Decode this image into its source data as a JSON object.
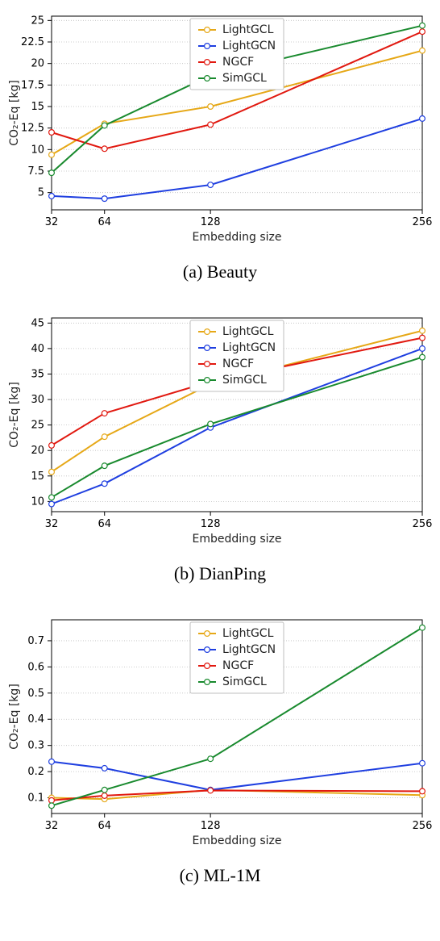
{
  "chart_data": [
    {
      "id": "beauty",
      "type": "line",
      "caption": "(a) Beauty",
      "xlabel": "Embedding size",
      "ylabel": "CO₂-Eq [kg]",
      "x_categories": [
        32,
        64,
        128,
        256
      ],
      "ylim": [
        3.0,
        25.5
      ],
      "yticks": [
        5.0,
        7.5,
        10.0,
        12.5,
        15.0,
        17.5,
        20.0,
        22.5,
        25.0
      ],
      "legend_pos": "top-center",
      "series": [
        {
          "name": "LightGCL",
          "color": "#e6a817",
          "values": [
            9.4,
            13.0,
            15.0,
            21.5
          ]
        },
        {
          "name": "LightGCN",
          "color": "#1f3fe0",
          "values": [
            4.6,
            4.3,
            5.9,
            13.6
          ]
        },
        {
          "name": "NGCF",
          "color": "#e11910",
          "values": [
            12.0,
            10.1,
            12.9,
            23.7
          ]
        },
        {
          "name": "SimGCL",
          "color": "#198a2e",
          "values": [
            7.3,
            12.8,
            18.6,
            24.4
          ]
        }
      ]
    },
    {
      "id": "dianping",
      "type": "line",
      "caption": "(b) DianPing",
      "xlabel": "Embedding size",
      "ylabel": "CO₂-Eq [kg]",
      "x_categories": [
        32,
        64,
        128,
        256
      ],
      "ylim": [
        8,
        46
      ],
      "yticks": [
        10,
        15,
        20,
        25,
        30,
        35,
        40,
        45
      ],
      "legend_pos": "top-center",
      "series": [
        {
          "name": "LightGCL",
          "color": "#e6a817",
          "values": [
            15.8,
            22.7,
            33.0,
            43.5
          ]
        },
        {
          "name": "LightGCN",
          "color": "#1f3fe0",
          "values": [
            9.5,
            13.5,
            24.5,
            40.0
          ]
        },
        {
          "name": "NGCF",
          "color": "#e11910",
          "values": [
            21.0,
            27.3,
            33.5,
            42.1
          ]
        },
        {
          "name": "SimGCL",
          "color": "#198a2e",
          "values": [
            10.8,
            17.0,
            25.2,
            38.3
          ]
        }
      ]
    },
    {
      "id": "ml1m",
      "type": "line",
      "caption": "(c) ML-1M",
      "xlabel": "Embedding size",
      "ylabel": "CO₂-Eq [kg]",
      "x_categories": [
        32,
        64,
        128,
        256
      ],
      "ylim": [
        0.04,
        0.78
      ],
      "yticks": [
        0.1,
        0.2,
        0.3,
        0.4,
        0.5,
        0.6,
        0.7
      ],
      "legend_pos": "top-center",
      "series": [
        {
          "name": "LightGCL",
          "color": "#e6a817",
          "values": [
            0.1,
            0.095,
            0.13,
            0.11
          ]
        },
        {
          "name": "LightGCN",
          "color": "#1f3fe0",
          "values": [
            0.238,
            0.213,
            0.13,
            0.232
          ]
        },
        {
          "name": "NGCF",
          "color": "#e11910",
          "values": [
            0.09,
            0.108,
            0.128,
            0.125
          ]
        },
        {
          "name": "SimGCL",
          "color": "#198a2e",
          "values": [
            0.07,
            0.13,
            0.249,
            0.75
          ]
        }
      ]
    }
  ]
}
